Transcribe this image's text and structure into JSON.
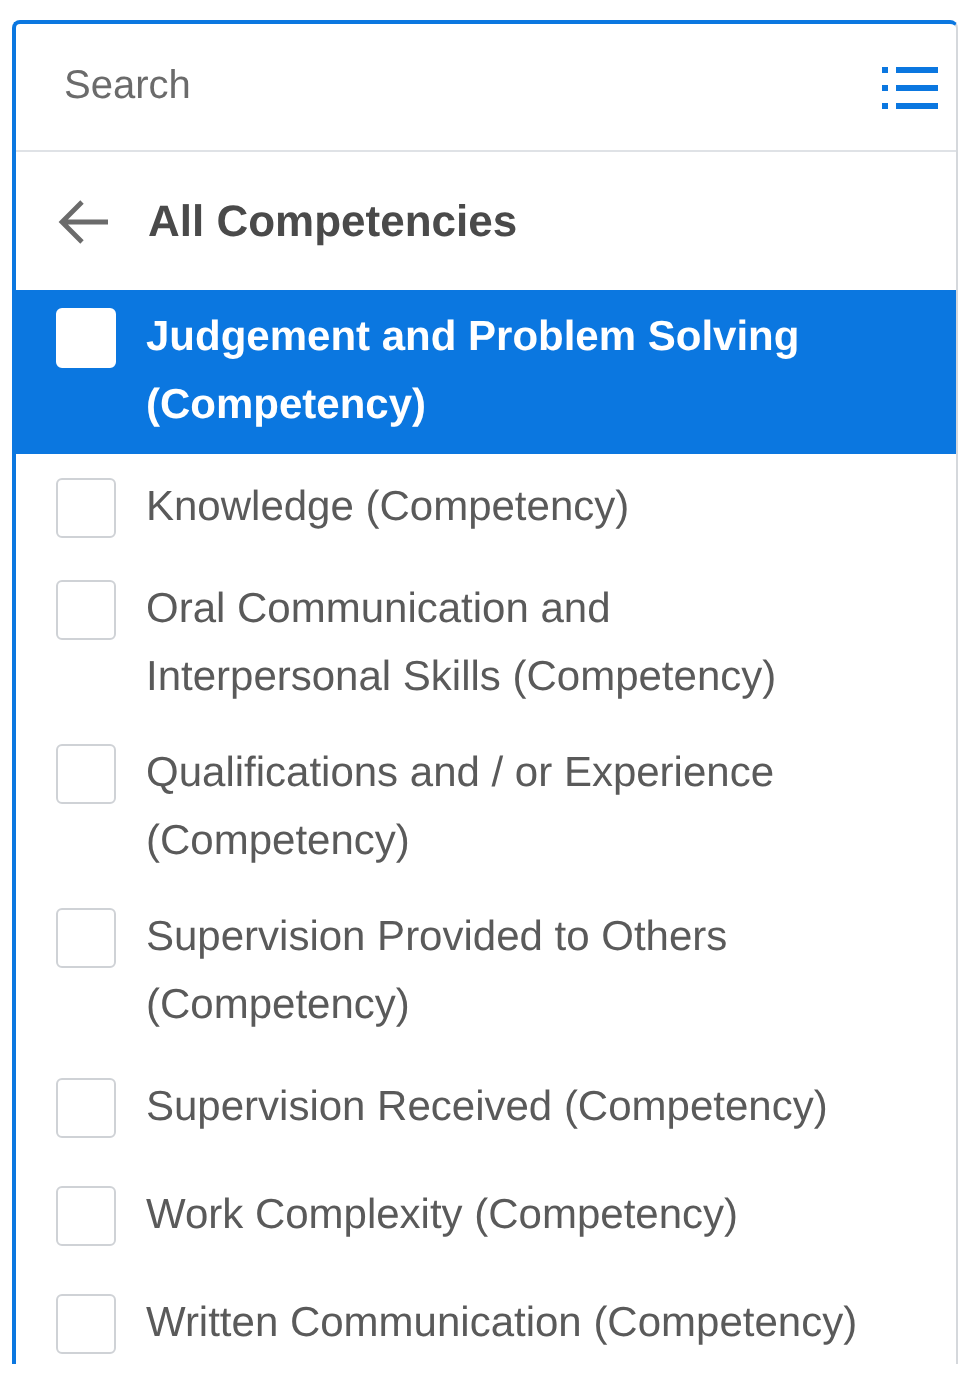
{
  "search": {
    "placeholder": "Search"
  },
  "header": {
    "title": "All Competencies"
  },
  "items": [
    {
      "lines": [
        "Judgement and Problem Solving",
        "(Competency)"
      ],
      "selected": true,
      "checked": false
    },
    {
      "lines": [
        "Knowledge (Competency)"
      ],
      "selected": false,
      "checked": false
    },
    {
      "lines": [
        "Oral Communication and",
        "Interpersonal Skills (Competency)"
      ],
      "selected": false,
      "checked": false
    },
    {
      "lines": [
        "Qualifications and / or Experience",
        "(Competency)"
      ],
      "selected": false,
      "checked": false
    },
    {
      "lines": [
        "Supervision Provided to Others",
        "(Competency)"
      ],
      "selected": false,
      "checked": false
    },
    {
      "lines": [
        "Supervision Received (Competency)"
      ],
      "selected": false,
      "checked": false
    },
    {
      "lines": [
        "Work Complexity (Competency)"
      ],
      "selected": false,
      "checked": false
    },
    {
      "lines": [
        "Written Communication (Competency)"
      ],
      "selected": false,
      "checked": false
    }
  ]
}
